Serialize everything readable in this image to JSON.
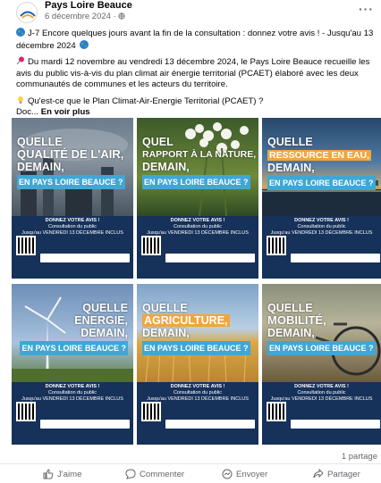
{
  "post": {
    "page_name": "Pays Loire Beauce",
    "date": "6 décembre 2024 · ",
    "more": "···",
    "line1": "J-7 Encore quelques jours avant la fin de la consultation : donnez votre avis ! - Jusqu'au 13 décembre 2024",
    "line2": "Du mardi 12 novembre au vendredi 13 décembre 2024, le Pays Loire Beauce recueille les avis du public vis-à-vis du plan climat air énergie territorial (PCAET) élaboré avec les deux communautés de communes et les acteurs du territoire.",
    "line3": "Qu'est-ce que le Plan Climat-Air-Energie Territorial (PCAET) ?",
    "line3b": "Doc...",
    "see_more": "En voir plus"
  },
  "tiles": [
    {
      "l1": "QUELLE",
      "l2": "QUALITÉ DE L'AIR,",
      "l3": "DEMAIN,",
      "l4": "EN PAYS LOIRE BEAUCE ?"
    },
    {
      "l1": "QUEL",
      "l2": "RAPPORT À LA NATURE,",
      "l3": "DEMAIN,",
      "l4": "EN PAYS LOIRE BEAUCE ?"
    },
    {
      "l1": "QUELLE",
      "l2": "RESSOURCE EN EAU,",
      "l3": "DEMAIN,",
      "l4": "EN PAYS LOIRE BEAUCE ?"
    },
    {
      "l1": "QUELLE",
      "l2": "ENERGIE,",
      "l3": "DEMAIN,",
      "l4": "EN PAYS LOIRE BEAUCE ?"
    },
    {
      "l1": "QUELLE",
      "l2": "AGRICULTURE,",
      "l3": "DEMAIN,",
      "l4": "EN PAYS LOIRE BEAUCE ?"
    },
    {
      "l1": "QUELLE",
      "l2": "MOBILITÉ,",
      "l3": "DEMAIN,",
      "l4": "EN PAYS LOIRE BEAUCE ?"
    }
  ],
  "tile_footer": {
    "cta": "DONNEZ VOTRE AVIS !",
    "sub1": "Consultation du public",
    "sub2": "Jusqu'au VENDREDI 13 DÉCEMBRE INCLUS"
  },
  "stats": {
    "shares": "1 partage"
  },
  "actions": {
    "like": "J'aime",
    "comment": "Commenter",
    "send": "Envoyer",
    "share": "Partager"
  },
  "colors": {
    "accent_orange": "#f3a53a",
    "accent_blue": "#3fa7d6",
    "footer_navy": "#16315a"
  }
}
